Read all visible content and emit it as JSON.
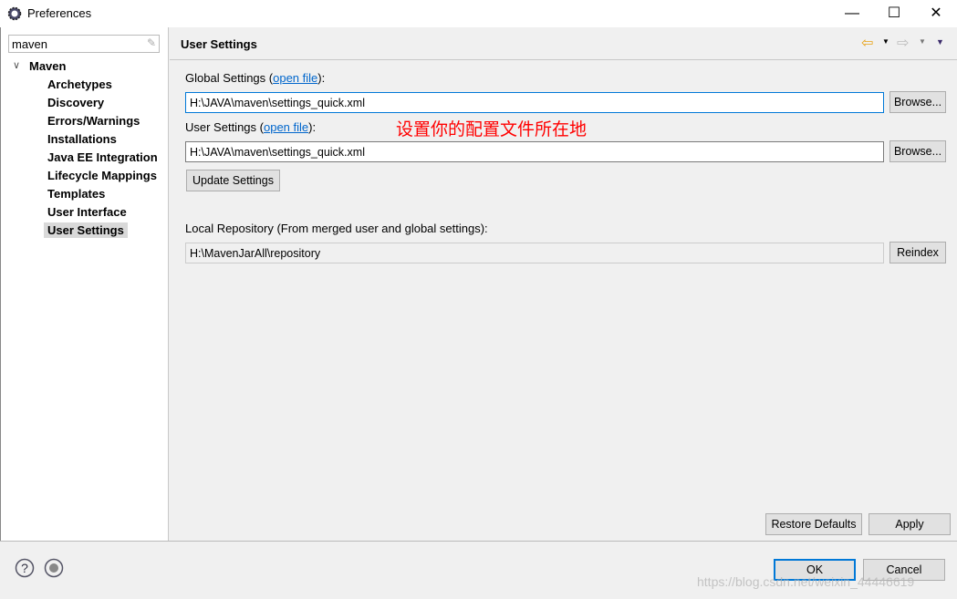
{
  "window": {
    "title": "Preferences",
    "minimize": "—",
    "maximize": "☐",
    "close": "✕"
  },
  "sidebar": {
    "filter_value": "maven",
    "root": "Maven",
    "items": [
      "Archetypes",
      "Discovery",
      "Errors/Warnings",
      "Installations",
      "Java EE Integration",
      "Lifecycle Mappings",
      "Templates",
      "User Interface",
      "User Settings"
    ],
    "selected": "User Settings"
  },
  "page": {
    "title": "User Settings",
    "global_label_pre": "Global Settings (",
    "global_link": "open file",
    "global_label_post": "):",
    "global_value": "H:\\JAVA\\maven\\settings_quick.xml",
    "user_label_pre": "User Settings (",
    "user_link": "open file",
    "user_label_post": "):",
    "user_value": "H:\\JAVA\\maven\\settings_quick.xml",
    "annotation": "设置你的配置文件所在地",
    "browse": "Browse...",
    "update": "Update Settings",
    "local_label": "Local Repository (From merged user and global settings):",
    "local_value": "H:\\MavenJarAll\\repository",
    "reindex": "Reindex",
    "restore": "Restore Defaults",
    "apply": "Apply"
  },
  "footer": {
    "ok": "OK",
    "cancel": "Cancel",
    "watermark": "https://blog.csdn.net/weixin_44446619"
  },
  "colors": {
    "annotation": "#ff0000",
    "link": "#0066cc",
    "ok_border": "#0078d7",
    "back_arrow": "#e8a317"
  }
}
